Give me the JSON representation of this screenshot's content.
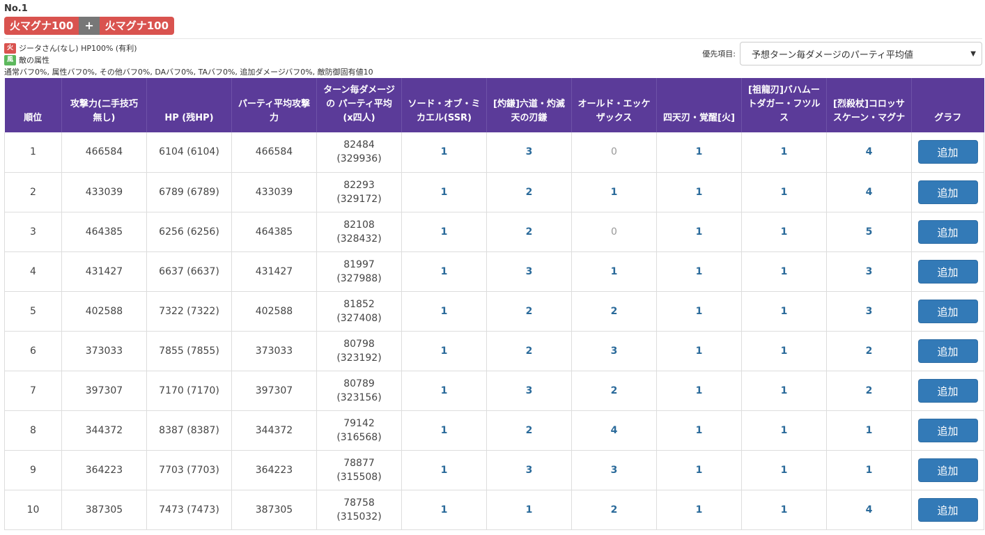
{
  "header": {
    "no_label": "No.1",
    "summon_left": "火マグナ100",
    "plus": "+",
    "summon_right": "火マグナ100"
  },
  "info": {
    "char_element_icon": "火",
    "char_line": "ジータさん(なし) HP100% (有利)",
    "enemy_element_icon": "風",
    "enemy_line": "敵の属性",
    "buff_line": "通常バフ0%, 属性バフ0%, その他バフ0%, DAバフ0%, TAバフ0%, 追加ダメージバフ0%, 敵防御固有値10"
  },
  "priority": {
    "label": "優先項目:",
    "selected": "予想ターン毎ダメージのパーティ平均値"
  },
  "table": {
    "headers": [
      "順位",
      "攻撃力(二手技巧無し)",
      "HP (残HP)",
      "パーティ平均攻撃力",
      "ターン毎ダメージの パーティ平均 (x四人)",
      "ソード・オブ・ミカエル(SSR)",
      "[灼鎌]六道・灼滅天の刃鎌",
      "オールド・エッケザックス",
      "四天刃・覚醒[火]",
      "[祖龍刃]バハムートダガー・フツルス",
      "[烈殺杖]コロッサスケーン・マグナ",
      "グラフ"
    ],
    "add_label": "追加",
    "rows": [
      {
        "rank": "1",
        "atk": "466584",
        "hp": "6104 (6104)",
        "avg": "466584",
        "dmg": "82484",
        "dmg4": "(329936)",
        "w": [
          "1",
          "3",
          "0",
          "1",
          "1",
          "4"
        ]
      },
      {
        "rank": "2",
        "atk": "433039",
        "hp": "6789 (6789)",
        "avg": "433039",
        "dmg": "82293",
        "dmg4": "(329172)",
        "w": [
          "1",
          "2",
          "1",
          "1",
          "1",
          "4"
        ]
      },
      {
        "rank": "3",
        "atk": "464385",
        "hp": "6256 (6256)",
        "avg": "464385",
        "dmg": "82108",
        "dmg4": "(328432)",
        "w": [
          "1",
          "2",
          "0",
          "1",
          "1",
          "5"
        ]
      },
      {
        "rank": "4",
        "atk": "431427",
        "hp": "6637 (6637)",
        "avg": "431427",
        "dmg": "81997",
        "dmg4": "(327988)",
        "w": [
          "1",
          "3",
          "1",
          "1",
          "1",
          "3"
        ]
      },
      {
        "rank": "5",
        "atk": "402588",
        "hp": "7322 (7322)",
        "avg": "402588",
        "dmg": "81852",
        "dmg4": "(327408)",
        "w": [
          "1",
          "2",
          "2",
          "1",
          "1",
          "3"
        ]
      },
      {
        "rank": "6",
        "atk": "373033",
        "hp": "7855 (7855)",
        "avg": "373033",
        "dmg": "80798",
        "dmg4": "(323192)",
        "w": [
          "1",
          "2",
          "3",
          "1",
          "1",
          "2"
        ]
      },
      {
        "rank": "7",
        "atk": "397307",
        "hp": "7170 (7170)",
        "avg": "397307",
        "dmg": "80789",
        "dmg4": "(323156)",
        "w": [
          "1",
          "3",
          "2",
          "1",
          "1",
          "2"
        ]
      },
      {
        "rank": "8",
        "atk": "344372",
        "hp": "8387 (8387)",
        "avg": "344372",
        "dmg": "79142",
        "dmg4": "(316568)",
        "w": [
          "1",
          "2",
          "4",
          "1",
          "1",
          "1"
        ]
      },
      {
        "rank": "9",
        "atk": "364223",
        "hp": "7703 (7703)",
        "avg": "364223",
        "dmg": "78877",
        "dmg4": "(315508)",
        "w": [
          "1",
          "3",
          "3",
          "1",
          "1",
          "1"
        ]
      },
      {
        "rank": "10",
        "atk": "387305",
        "hp": "7473 (7473)",
        "avg": "387305",
        "dmg": "78758",
        "dmg4": "(315032)",
        "w": [
          "1",
          "1",
          "2",
          "1",
          "1",
          "4"
        ]
      }
    ]
  }
}
